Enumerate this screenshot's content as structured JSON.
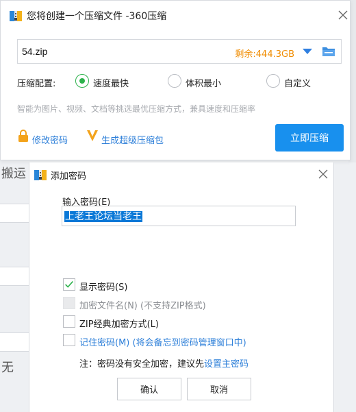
{
  "compress_dialog": {
    "title": "您将创建一个压缩文件 -360压缩",
    "file_name": "54.zip",
    "free_space": "剩余:444.3GB",
    "config_label": "压缩配置:",
    "options": [
      {
        "label": "速度最快",
        "selected": true
      },
      {
        "label": "体积最小",
        "selected": false
      },
      {
        "label": "自定义",
        "selected": false
      }
    ],
    "hint": "智能为图片、视频、文档等挑选最优压缩方式，兼具速度和压缩率",
    "change_password": "修改密码",
    "super_package": "生成超级压缩包",
    "compress_now": "立即压缩"
  },
  "background": {
    "left_text_1": "搬运",
    "left_text_2": "无"
  },
  "password_dialog": {
    "title": "添加密码",
    "input_label": "输入密码(E)",
    "password_value": "上老王论坛当老王",
    "checks": [
      {
        "label": "显示密码(S)",
        "checked": true,
        "disabled": false
      },
      {
        "label": "加密文件名(N) (不支持ZIP格式)",
        "checked": false,
        "disabled": true
      },
      {
        "label": "ZIP经典加密方式(L)",
        "checked": false,
        "disabled": false
      },
      {
        "label": "记住密码(M) (将会备忘到密码管理窗口中)",
        "checked": false,
        "disabled": false
      }
    ],
    "note_prefix": "注：密码没有安全加密，建议先",
    "note_link": "设置主密码",
    "ok": "确认",
    "cancel": "取消"
  },
  "colors": {
    "accent_blue": "#1890ee",
    "link_blue": "#2d7fd9",
    "space_orange": "#f08c00",
    "radio_green": "#2db24c"
  },
  "icons": [
    "app-icon",
    "close-icon",
    "dropdown-icon",
    "folder-icon",
    "lock-icon",
    "v-logo-icon",
    "checkmark-icon"
  ]
}
